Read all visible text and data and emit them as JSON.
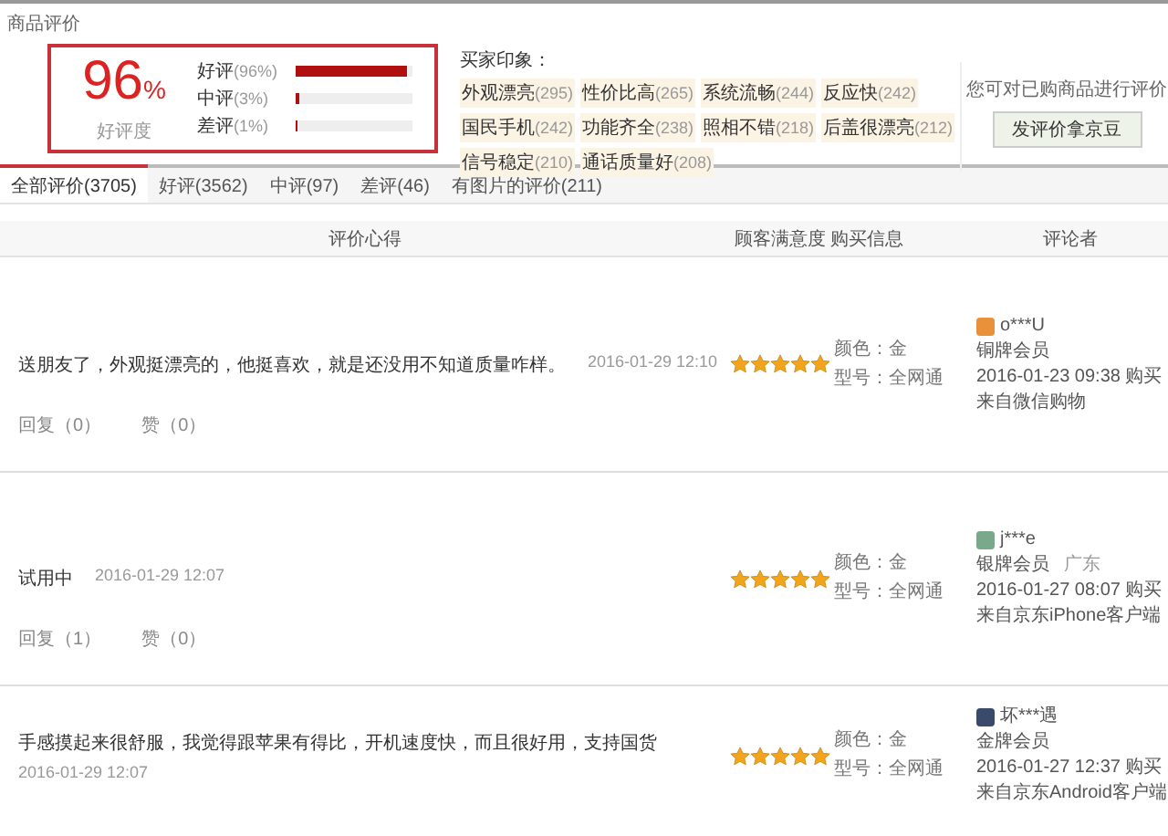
{
  "section_title": "商品评价",
  "summary": {
    "percent": "96",
    "percent_sign": "%",
    "label": "好评度",
    "bars": [
      {
        "label": "好评",
        "share": "(96%)",
        "level": 0.96
      },
      {
        "label": "中评",
        "share": "(3%)",
        "level": 0.03
      },
      {
        "label": "差评",
        "share": "(1%)",
        "level": 0.01
      }
    ]
  },
  "impressions": {
    "title": "买家印象：",
    "tags": [
      {
        "text": "外观漂亮",
        "count": "(295)"
      },
      {
        "text": "性价比高",
        "count": "(265)"
      },
      {
        "text": "系统流畅",
        "count": "(244)"
      },
      {
        "text": "反应快",
        "count": "(242)"
      },
      {
        "text": "国民手机",
        "count": "(242)"
      },
      {
        "text": "功能齐全",
        "count": "(238)"
      },
      {
        "text": "照相不错",
        "count": "(218)"
      },
      {
        "text": "后盖很漂亮",
        "count": "(212)"
      },
      {
        "text": "信号稳定",
        "count": "(210)"
      },
      {
        "text": "通话质量好",
        "count": "(208)"
      }
    ]
  },
  "review_prompt": {
    "text": "您可对已购商品进行评价",
    "button": "发评价拿京豆"
  },
  "tabs": [
    {
      "label": "全部评价(3705)",
      "selected": true
    },
    {
      "label": "好评(3562)",
      "selected": false
    },
    {
      "label": "中评(97)",
      "selected": false
    },
    {
      "label": "差评(46)",
      "selected": false
    },
    {
      "label": "有图片的评价(211)",
      "selected": false
    }
  ],
  "columns": [
    "评价心得",
    "顾客满意度",
    "购买信息",
    "评论者"
  ],
  "reviews": [
    {
      "text": "送朋友了，外观挺漂亮的，他挺喜欢，就是还没用不知道质量咋样。",
      "date": "2016-01-29 12:10",
      "replies": "回复（0）",
      "likes": "赞（0）",
      "stars": 5,
      "variant_color": "颜色：金",
      "variant_model": "型号：全网通",
      "user": "o***U",
      "color": "#e8903a",
      "level": "铜牌会员",
      "bought": "2016-01-23 09:38 购买",
      "source": "来自微信购物"
    },
    {
      "text": "试用中",
      "date": "2016-01-29 12:07",
      "replies": "回复（1）",
      "likes": "赞（0）",
      "stars": 5,
      "variant_color": "颜色：金",
      "variant_model": "型号：全网通",
      "user": "j***e",
      "color": "#7aa88a",
      "level": "银牌会员",
      "region": "广东",
      "bought": "2016-01-27 08:07 购买",
      "source": "来自京东iPhone客户端"
    },
    {
      "text": "手感摸起来很舒服，我觉得跟苹果有得比，开机速度快，而且很好用，支持国货",
      "date": "2016-01-29 12:07",
      "stars": 5,
      "variant_color": "颜色：金",
      "variant_model": "型号：全网通",
      "user": "坏***遇",
      "color": "#3a4a6a",
      "level": "金牌会员",
      "bought": "2016-01-27 12:37 购买",
      "source": "来自京东Android客户端"
    }
  ]
}
